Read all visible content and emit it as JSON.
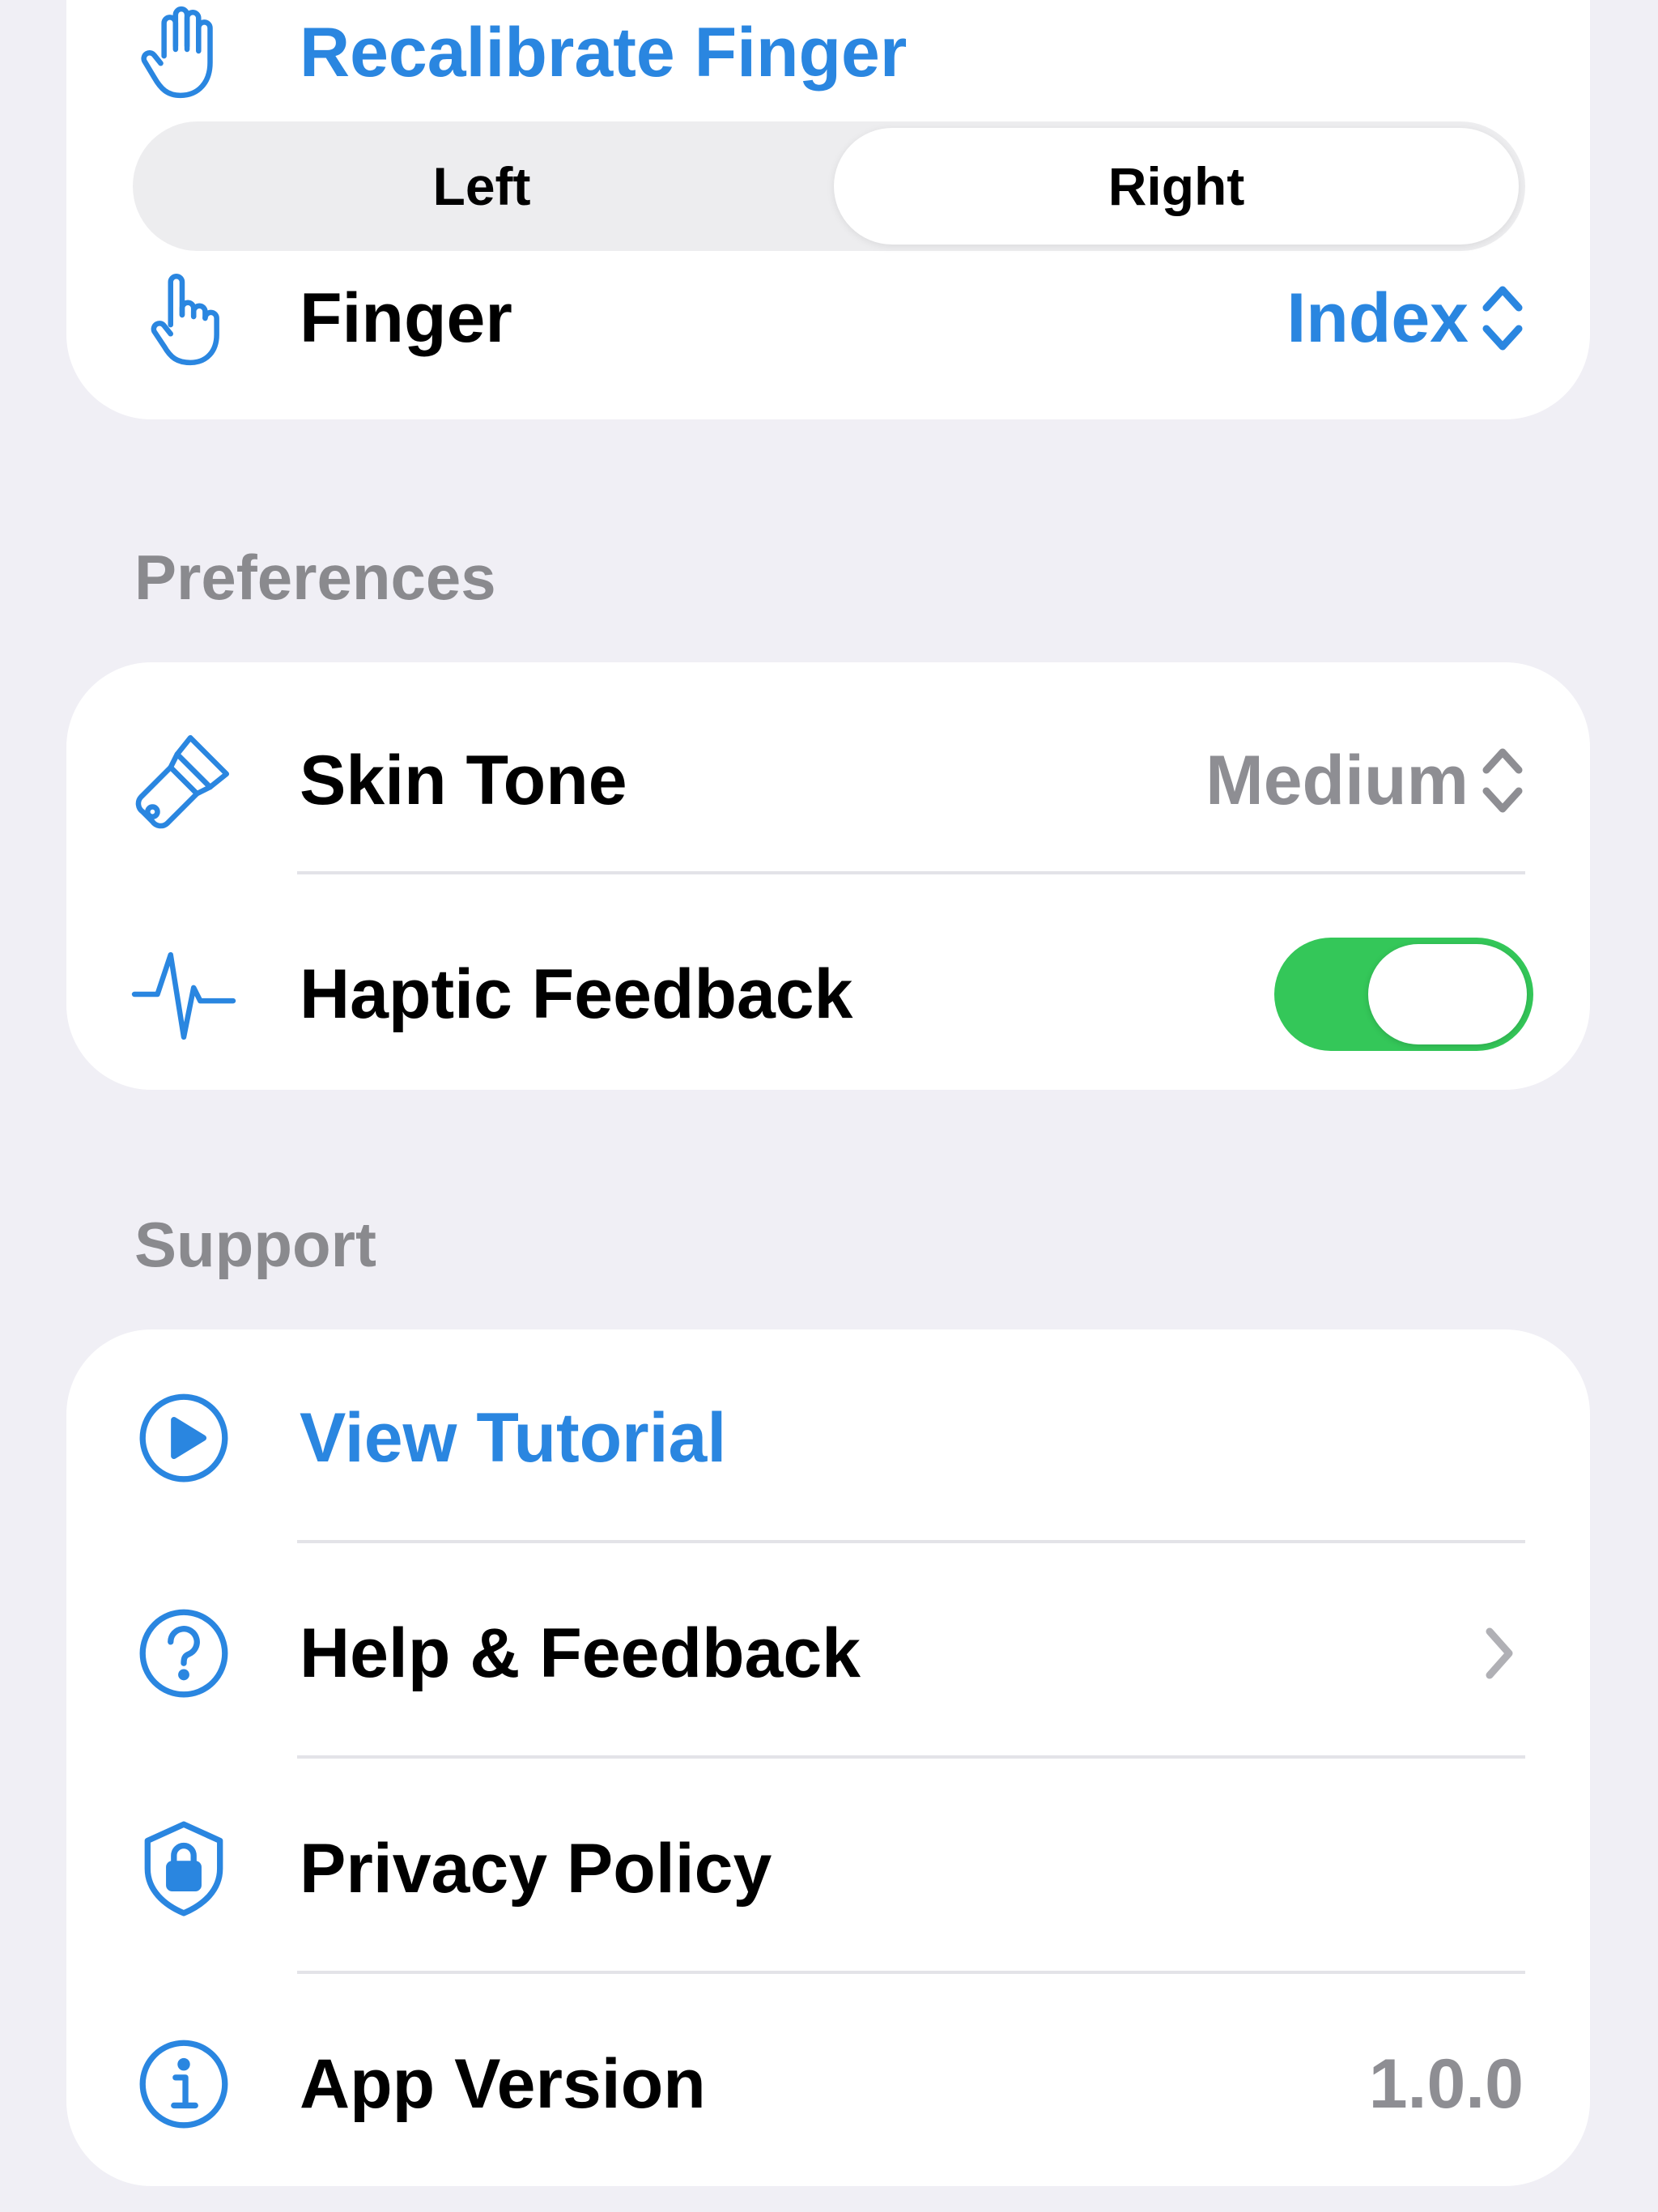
{
  "accent_color": "#2A86E0",
  "top_card": {
    "recalibrate": {
      "icon": "hand-raised-icon",
      "label": "Recalibrate Finger"
    },
    "hand_selector": {
      "options": [
        "Left",
        "Right"
      ],
      "selected": "Right"
    },
    "finger": {
      "icon": "hand-point-up-icon",
      "label": "Finger",
      "value": "Index",
      "picker_icon": "chevron-up-down-icon"
    }
  },
  "preferences": {
    "header": "Preferences",
    "skin_tone": {
      "icon": "paintbrush-icon",
      "label": "Skin Tone",
      "value": "Medium",
      "picker_icon": "chevron-up-down-icon"
    },
    "haptic": {
      "icon": "waveform-icon",
      "label": "Haptic Feedback",
      "enabled": true,
      "toggle_color": "#34C759"
    }
  },
  "support": {
    "header": "Support",
    "view_tutorial": {
      "icon": "play-circle-icon",
      "label": "View Tutorial"
    },
    "help": {
      "icon": "question-circle-icon",
      "label": "Help & Feedback",
      "accessory_icon": "chevron-right-icon"
    },
    "privacy": {
      "icon": "shield-lock-icon",
      "label": "Privacy Policy"
    },
    "app_version": {
      "icon": "info-circle-icon",
      "label": "App Version",
      "value": "1.0.0"
    }
  }
}
